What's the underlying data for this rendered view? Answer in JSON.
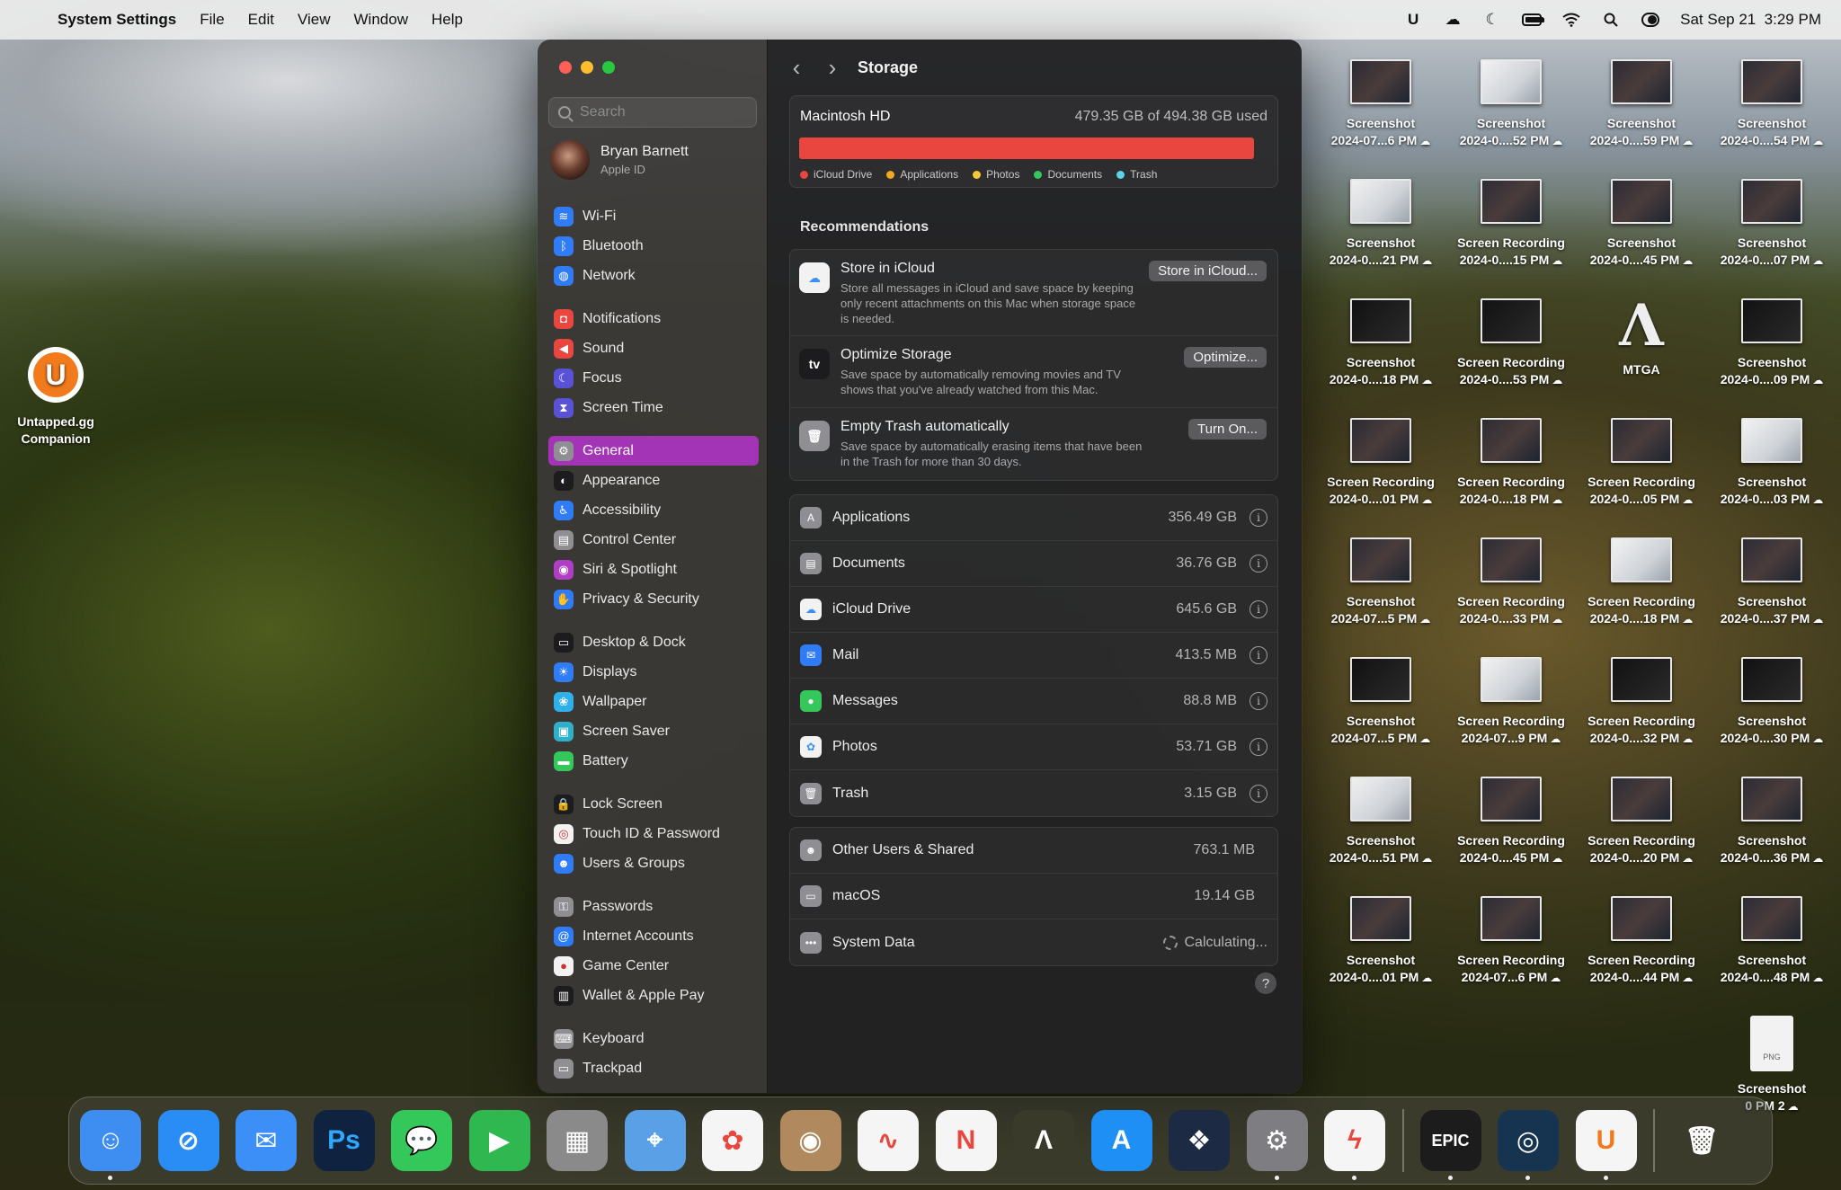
{
  "menubar": {
    "app_name": "System Settings",
    "items": [
      "File",
      "Edit",
      "View",
      "Window",
      "Help"
    ],
    "clock": "Sat Sep 21  3:29 PM",
    "status_icons": [
      "untapped-icon",
      "cloud-sync-icon",
      "moon-icon",
      "battery-icon",
      "wifi-icon",
      "search-icon",
      "control-center-icon"
    ]
  },
  "sidebar": {
    "search_placeholder": "Search",
    "profile": {
      "name": "Bryan Barnett",
      "subtitle": "Apple ID"
    },
    "groups": [
      [
        {
          "label": "Wi-Fi",
          "icon": "wifi-icon",
          "color": "#2f7cf6"
        },
        {
          "label": "Bluetooth",
          "icon": "bluetooth-icon",
          "color": "#2f7cf6"
        },
        {
          "label": "Network",
          "icon": "globe-icon",
          "color": "#2f7cf6"
        }
      ],
      [
        {
          "label": "Notifications",
          "icon": "bell-icon",
          "color": "#e8463e"
        },
        {
          "label": "Sound",
          "icon": "speaker-icon",
          "color": "#e8463e"
        },
        {
          "label": "Focus",
          "icon": "moon-icon",
          "color": "#5a52d6"
        },
        {
          "label": "Screen Time",
          "icon": "hourglass-icon",
          "color": "#5a52d6"
        }
      ],
      [
        {
          "label": "General",
          "icon": "gear-icon",
          "color": "#8e8e93",
          "active": true
        },
        {
          "label": "Appearance",
          "icon": "circle-half-icon",
          "color": "#1c1c1e"
        },
        {
          "label": "Accessibility",
          "icon": "accessibility-icon",
          "color": "#2f7cf6"
        },
        {
          "label": "Control Center",
          "icon": "control-center-icon",
          "color": "#8e8e93"
        },
        {
          "label": "Siri & Spotlight",
          "icon": "siri-icon",
          "color": "#b03ec2"
        },
        {
          "label": "Privacy & Security",
          "icon": "hand-icon",
          "color": "#2f7cf6"
        }
      ],
      [
        {
          "label": "Desktop & Dock",
          "icon": "dock-icon",
          "color": "#1c1c1e"
        },
        {
          "label": "Displays",
          "icon": "sun-icon",
          "color": "#2f7cf6"
        },
        {
          "label": "Wallpaper",
          "icon": "wallpaper-icon",
          "color": "#2fb0e8"
        },
        {
          "label": "Screen Saver",
          "icon": "screensaver-icon",
          "color": "#2fb0c8"
        },
        {
          "label": "Battery",
          "icon": "battery-icon",
          "color": "#34c759"
        }
      ],
      [
        {
          "label": "Lock Screen",
          "icon": "lock-icon",
          "color": "#1c1c1e"
        },
        {
          "label": "Touch ID & Password",
          "icon": "fingerprint-icon",
          "color": "#f2f2f2"
        },
        {
          "label": "Users & Groups",
          "icon": "users-icon",
          "color": "#2f7cf6"
        }
      ],
      [
        {
          "label": "Passwords",
          "icon": "key-icon",
          "color": "#8e8e93"
        },
        {
          "label": "Internet Accounts",
          "icon": "at-icon",
          "color": "#2f7cf6"
        },
        {
          "label": "Game Center",
          "icon": "game-center-icon",
          "color": "#f2f2f2"
        },
        {
          "label": "Wallet & Apple Pay",
          "icon": "wallet-icon",
          "color": "#1c1c1e"
        }
      ],
      [
        {
          "label": "Keyboard",
          "icon": "keyboard-icon",
          "color": "#8e8e93"
        },
        {
          "label": "Trackpad",
          "icon": "trackpad-icon",
          "color": "#8e8e93"
        }
      ]
    ]
  },
  "content": {
    "title": "Storage",
    "disk": {
      "name": "Macintosh HD",
      "used_text": "479.35 GB of 494.38 GB used",
      "used_fraction": 0.97,
      "legend": [
        {
          "label": "iCloud Drive",
          "color": "#e8463e"
        },
        {
          "label": "Applications",
          "color": "#f5a623"
        },
        {
          "label": "Photos",
          "color": "#f7c73a"
        },
        {
          "label": "Documents",
          "color": "#34c759"
        },
        {
          "label": "Trash",
          "color": "#5ad4e6"
        }
      ]
    },
    "recommendations_title": "Recommendations",
    "recommendations": [
      {
        "title": "Store in iCloud",
        "description": "Store all messages in iCloud and save space by keeping only recent attachments on this Mac when storage space is needed.",
        "button": "Store in iCloud...",
        "icon": "icloud-icon"
      },
      {
        "title": "Optimize Storage",
        "description": "Save space by automatically removing movies and TV shows that you've already watched from this Mac.",
        "button": "Optimize...",
        "icon": "appletv-icon"
      },
      {
        "title": "Empty Trash automatically",
        "description": "Save space by automatically erasing items that have been in the Trash for more than 30 days.",
        "button": "Turn On...",
        "icon": "trash-icon"
      }
    ],
    "categories": [
      {
        "label": "Applications",
        "size": "356.49 GB",
        "icon": "applications-icon",
        "color": "#8e8e93"
      },
      {
        "label": "Documents",
        "size": "36.76 GB",
        "icon": "document-icon",
        "color": "#8e8e93"
      },
      {
        "label": "iCloud Drive",
        "size": "645.6 GB",
        "icon": "icloud-icon",
        "color": "#f2f2f2"
      },
      {
        "label": "Mail",
        "size": "413.5 MB",
        "icon": "mail-icon",
        "color": "#2f7cf6"
      },
      {
        "label": "Messages",
        "size": "88.8 MB",
        "icon": "messages-icon",
        "color": "#34c759"
      },
      {
        "label": "Photos",
        "size": "53.71 GB",
        "icon": "photos-icon",
        "color": "#f2f2f2"
      },
      {
        "label": "Trash",
        "size": "3.15 GB",
        "icon": "trash-icon",
        "color": "#8e8e93"
      }
    ],
    "system": [
      {
        "label": "Other Users & Shared",
        "size": "763.1 MB",
        "icon": "users-icon"
      },
      {
        "label": "macOS",
        "size": "19.14 GB",
        "icon": "macos-icon"
      },
      {
        "label": "System Data",
        "size": "Calculating...",
        "icon": "ellipsis-icon",
        "loading": true
      }
    ],
    "help": "?"
  },
  "desktop": {
    "left_icon": {
      "label": "Untapped.gg",
      "sub": "Companion"
    },
    "columns": [
      [
        {
          "l1": "Screenshot",
          "l2": "2024-07...6 PM"
        },
        {
          "l1": "Screenshot",
          "l2": "2024-0....21 PM"
        },
        {
          "l1": "Screenshot",
          "l2": "2024-0....18 PM"
        },
        {
          "l1": "Screen Recording",
          "l2": "2024-0....01 PM"
        },
        {
          "l1": "Screenshot",
          "l2": "2024-07...5 PM"
        },
        {
          "l1": "Screenshot",
          "l2": "2024-07...5 PM"
        },
        {
          "l1": "Screenshot",
          "l2": "2024-0....51 PM"
        },
        {
          "l1": "Screenshot",
          "l2": "2024-0....01 PM"
        }
      ],
      [
        {
          "l1": "Screenshot",
          "l2": "2024-0....52 PM"
        },
        {
          "l1": "Screen Recording",
          "l2": "2024-0....15 PM"
        },
        {
          "l1": "Screen Recording",
          "l2": "2024-0....53 PM"
        },
        {
          "l1": "Screen Recording",
          "l2": "2024-0....18 PM"
        },
        {
          "l1": "Screen Recording",
          "l2": "2024-0....33 PM"
        },
        {
          "l1": "Screen Recording",
          "l2": "2024-07...9 PM"
        },
        {
          "l1": "Screen Recording",
          "l2": "2024-0....45 PM"
        },
        {
          "l1": "Screen Recording",
          "l2": "2024-07...6 PM"
        }
      ],
      [
        {
          "l1": "Screenshot",
          "l2": "2024-0....59 PM"
        },
        {
          "l1": "Screenshot",
          "l2": "2024-0....45 PM"
        },
        {
          "l1": "MTGA",
          "l2": ""
        },
        {
          "l1": "Screen Recording",
          "l2": "2024-0....05 PM"
        },
        {
          "l1": "Screen Recording",
          "l2": "2024-0....18 PM"
        },
        {
          "l1": "Screen Recording",
          "l2": "2024-0....32 PM"
        },
        {
          "l1": "Screen Recording",
          "l2": "2024-0....20 PM"
        },
        {
          "l1": "Screen Recording",
          "l2": "2024-0....44 PM"
        }
      ],
      [
        {
          "l1": "Screenshot",
          "l2": "2024-0....54 PM"
        },
        {
          "l1": "Screenshot",
          "l2": "2024-0....07 PM"
        },
        {
          "l1": "Screenshot",
          "l2": "2024-0....09 PM"
        },
        {
          "l1": "Screenshot",
          "l2": "2024-0....03 PM"
        },
        {
          "l1": "Screenshot",
          "l2": "2024-0....37 PM"
        },
        {
          "l1": "Screenshot",
          "l2": "2024-0....30 PM"
        },
        {
          "l1": "Screenshot",
          "l2": "2024-0....36 PM"
        },
        {
          "l1": "Screenshot",
          "l2": "2024-0....48 PM"
        },
        {
          "l1": "Screenshot",
          "l2": "0 PM 2"
        }
      ]
    ]
  },
  "dock": [
    {
      "name": "Finder",
      "icon": "finder-icon",
      "color": "#3d8ef0",
      "glyph": "☺",
      "running": true
    },
    {
      "name": "Safari",
      "icon": "safari-icon",
      "color": "#2a8cf5",
      "glyph": "⊘",
      "running": false
    },
    {
      "name": "Mail",
      "icon": "mail-icon",
      "color": "#3b8ff6",
      "glyph": "✉",
      "running": false
    },
    {
      "name": "Photoshop",
      "icon": "photoshop-icon",
      "color": "#0f2340",
      "glyph": "Ps",
      "running": false
    },
    {
      "name": "Messages",
      "icon": "messages-icon",
      "color": "#34c759",
      "glyph": "💬",
      "running": false
    },
    {
      "name": "FaceTime",
      "icon": "facetime-icon",
      "color": "#2fb84f",
      "glyph": "▶",
      "running": false
    },
    {
      "name": "Launchpad",
      "icon": "launchpad-icon",
      "color": "#8a8a8a",
      "glyph": "▦",
      "running": false
    },
    {
      "name": "Maps",
      "icon": "maps-icon",
      "color": "#5aa0e6",
      "glyph": "⌖",
      "running": false
    },
    {
      "name": "Photos",
      "icon": "photos-icon",
      "color": "#f5f5f5",
      "glyph": "✿",
      "running": false
    },
    {
      "name": "Contacts",
      "icon": "contacts-icon",
      "color": "#b08a5e",
      "glyph": "◉",
      "running": false
    },
    {
      "name": "Freeform",
      "icon": "freeform-icon",
      "color": "#f5f5f5",
      "glyph": "∿",
      "running": false
    },
    {
      "name": "News",
      "icon": "news-icon",
      "color": "#f5f5f5",
      "glyph": "N",
      "running": false
    },
    {
      "name": "MTGA",
      "icon": "mtga-icon",
      "color": "#3a3a2a",
      "glyph": "Λ",
      "running": false
    },
    {
      "name": "App Store",
      "icon": "app-store-icon",
      "color": "#1d8ff5",
      "glyph": "A",
      "running": false
    },
    {
      "name": "DaVinci Resolve",
      "icon": "davinci-icon",
      "color": "#1c2a44",
      "glyph": "❖",
      "running": false
    },
    {
      "name": "System Settings",
      "icon": "system-settings-icon",
      "color": "#7d7d82",
      "glyph": "⚙",
      "running": true
    },
    {
      "name": "Messenger",
      "icon": "messenger-icon",
      "color": "#f5f5f5",
      "glyph": "ϟ",
      "running": true
    },
    {
      "name": "Epic Games",
      "icon": "epic-games-icon",
      "color": "#1c1c1c",
      "glyph": "EPIC",
      "running": true
    },
    {
      "name": "Steam",
      "icon": "steam-icon",
      "color": "#16334f",
      "glyph": "◎",
      "running": true
    },
    {
      "name": "Untapped.gg",
      "icon": "untapped-icon",
      "color": "#f5f5f5",
      "glyph": "U",
      "running": true
    },
    {
      "name": "Trash",
      "icon": "trash-icon",
      "color": "transparent",
      "glyph": "🗑",
      "running": false
    }
  ]
}
